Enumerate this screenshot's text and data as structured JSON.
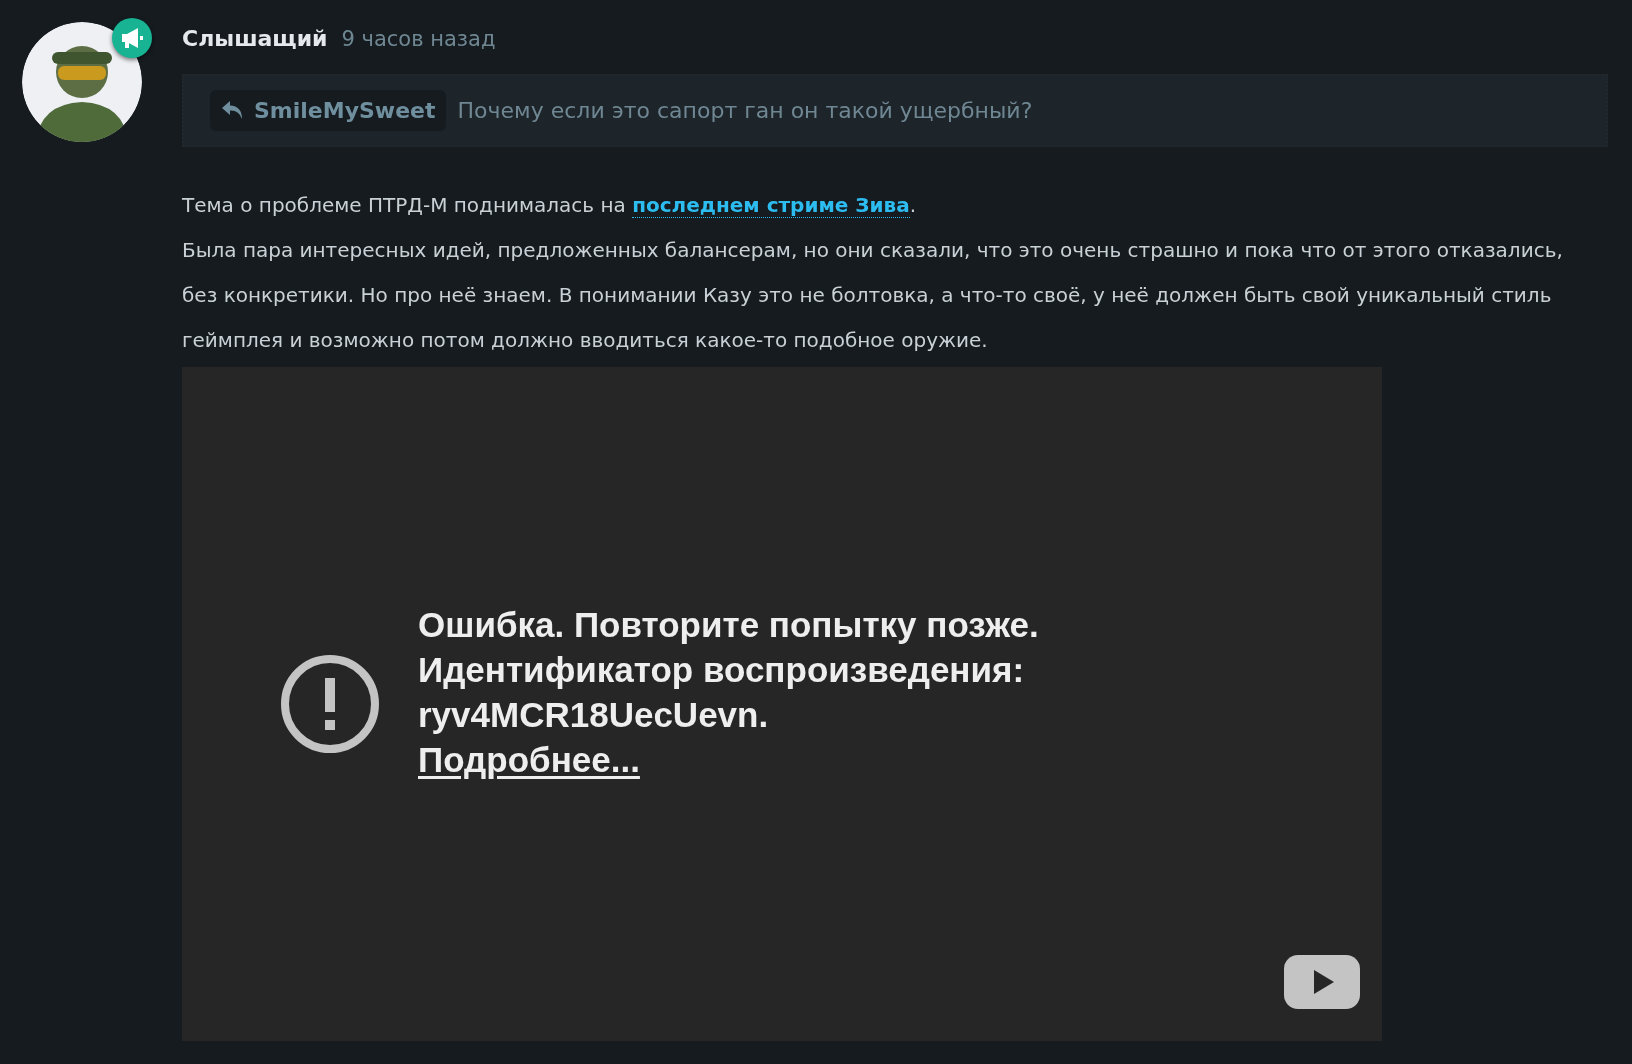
{
  "comment": {
    "author": "Слышащий",
    "time": "9 часов назад",
    "reply_to": {
      "user": "SmileMySweet",
      "text": "Почему если это сапорт ган он такой ущербный?"
    },
    "paragraphs": [
      {
        "text": "Тема о проблеме ПТРД-М поднималась на ",
        "link": "последнем стриме Зива",
        "after": "."
      },
      {
        "text": "Была пара интересных идей, предложенных балансерам, но они сказали, что это очень страшно и пока что от этого отказались, без конкретики. Но про неё знаем. В понимании Казу это не болтовка, а что-то своё, у неё должен быть свой уникальный стиль геймплея и возможно потом должно вводиться какое-то подобное оружие."
      }
    ],
    "video": {
      "error_lines": [
        "Ошибка. Повторите попытку позже.",
        "Идентификатор воспроизведения:",
        "ryv4MCR18UecUevn."
      ],
      "more_link": "Подробнее..."
    }
  }
}
